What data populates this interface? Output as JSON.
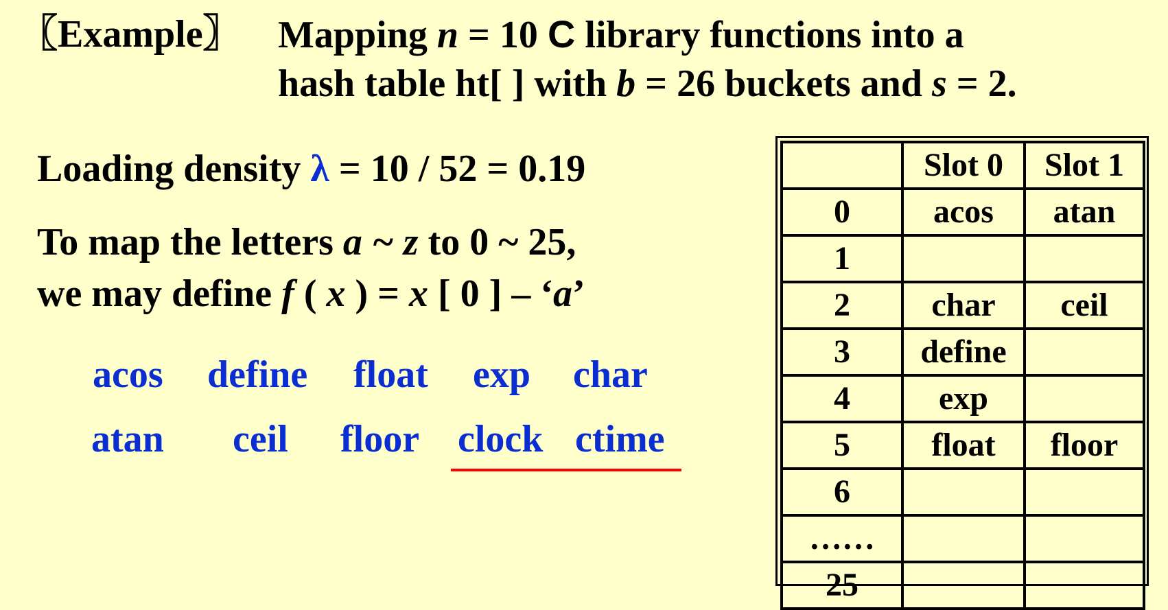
{
  "title": {
    "tag": "〖Example〗",
    "line1_pre": "Mapping ",
    "n_var": "n",
    "line1_eq": " = 10  ",
    "c_letter": "C",
    "line1_post": " library functions into a",
    "line2_pre": "hash table ht[ ] with ",
    "b_var": "b",
    "line2_mid": " = 26 buckets and ",
    "s_var": "s",
    "line2_post": " = 2."
  },
  "density": {
    "label": "Loading density ",
    "lambda": "λ",
    "eq": " =  10 / 52 = 0.19"
  },
  "mapping": {
    "line1_pre": "To map the letters  ",
    "range_var": "a ~ z",
    "line1_post": "  to 0 ~ 25,",
    "line2_pre": "we may define  ",
    "f_var": "f",
    "paren_open": " ( ",
    "x_var": "x",
    "line2_mid": " ) =  ",
    "x_var2": "x",
    "line2_post": " [ 0 ] – ‘",
    "a_var": "a",
    "close_quote": "’"
  },
  "identifiers": {
    "row1": [
      "acos",
      "define",
      "float",
      "exp",
      "char"
    ],
    "row2": [
      "atan",
      "ceil",
      "floor",
      "clock",
      "ctime"
    ]
  },
  "table": {
    "headers": [
      "",
      "Slot 0",
      "Slot 1"
    ],
    "rows": [
      {
        "idx": "0",
        "s0": "acos",
        "s1": "atan"
      },
      {
        "idx": "1",
        "s0": "",
        "s1": ""
      },
      {
        "idx": "2",
        "s0": "char",
        "s1": "ceil"
      },
      {
        "idx": "3",
        "s0": "define",
        "s1": ""
      },
      {
        "idx": "4",
        "s0": "exp",
        "s1": ""
      },
      {
        "idx": "5",
        "s0": "float",
        "s1": "floor"
      },
      {
        "idx": "6",
        "s0": "",
        "s1": ""
      },
      {
        "idx": "……",
        "s0": "",
        "s1": ""
      },
      {
        "idx": "25",
        "s0": "",
        "s1": ""
      }
    ]
  },
  "colors": {
    "background": "#ffffcc",
    "identifier_blue": "#0a2ed1",
    "underline_red": "#ff0000"
  }
}
